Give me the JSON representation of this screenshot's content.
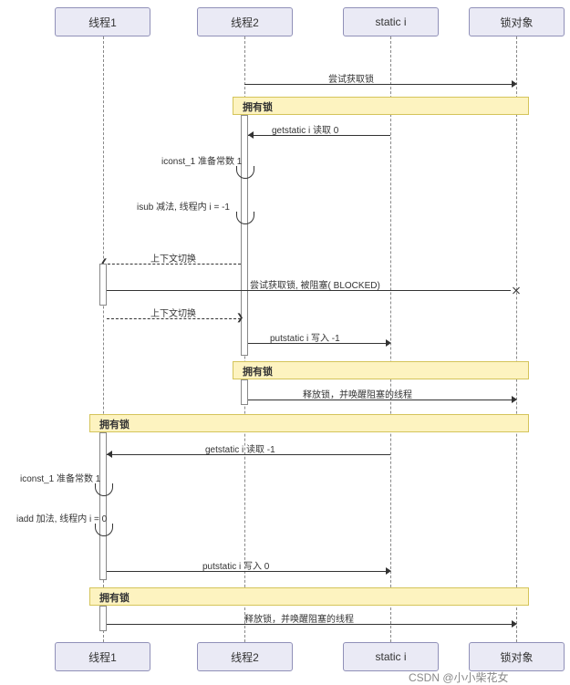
{
  "participants": [
    "线程1",
    "线程2",
    "static i",
    "锁对象"
  ],
  "fragments": {
    "frag1": "拥有锁",
    "frag2": "拥有锁",
    "frag3": "拥有锁",
    "frag4": "拥有锁"
  },
  "messages": {
    "m1": "尝试获取锁",
    "m2": "getstatic i 读取 0",
    "m3": "iconst_1 准备常数 1",
    "m4": "isub 减法, 线程内 i = -1",
    "m5": "上下文切换",
    "m6": "尝试获取锁, 被阻塞( BLOCKED)",
    "m7": "上下文切换",
    "m8": "putstatic i 写入 -1",
    "m9": "释放锁，并唤醒阻塞的线程",
    "m10": "getstatic i 读取 -1",
    "m11": "iconst_1 准备常数 1",
    "m12": "iadd 加法, 线程内 i = 0",
    "m13": "putstatic i 写入 0",
    "m14": "释放锁，并唤醒阻塞的线程"
  },
  "watermark": "CSDN @小小柴花女"
}
